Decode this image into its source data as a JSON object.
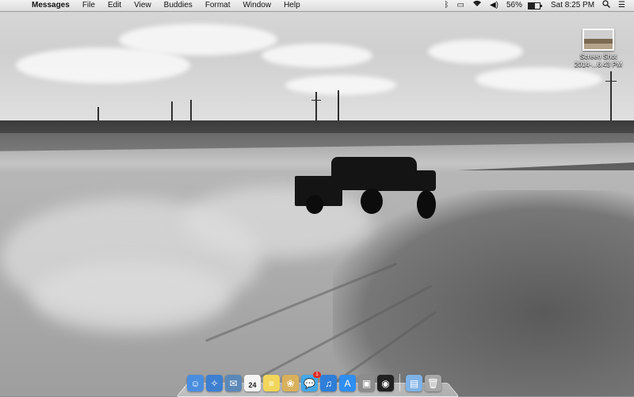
{
  "menubar": {
    "apple": "",
    "app_name": "Messages",
    "items": [
      "File",
      "Edit",
      "View",
      "Buddies",
      "Format",
      "Window",
      "Help"
    ],
    "status": {
      "bluetooth": "bluetooth-icon",
      "airplay": "airplay-icon",
      "wifi": "wifi-icon",
      "volume": "volume-icon",
      "battery_percent": "56%",
      "battery_level": 0.56,
      "clock": "Sat 8:25 PM",
      "search": "search-icon",
      "notification_center": "list-icon"
    }
  },
  "desktop": {
    "file": {
      "line1": "Screen Shot",
      "line2": "2014-...6.43 PM"
    }
  },
  "dock": {
    "items": [
      {
        "name": "finder",
        "icon": "finder-icon",
        "color": "#4a8ee0"
      },
      {
        "name": "safari",
        "icon": "safari-icon",
        "color": "#3d7fd0"
      },
      {
        "name": "mail",
        "icon": "mail-icon",
        "color": "#5b88b8"
      },
      {
        "name": "calendar",
        "icon": "calendar-icon",
        "color": "#f4f4f4",
        "label": "24"
      },
      {
        "name": "notes",
        "icon": "notes-icon",
        "color": "#f2d65a"
      },
      {
        "name": "photos",
        "icon": "photos-icon",
        "color": "#d9b15c"
      },
      {
        "name": "messages",
        "icon": "messages-icon",
        "color": "#44a7e8",
        "badge": "1"
      },
      {
        "name": "itunes",
        "icon": "itunes-icon",
        "color": "#2f7ed8"
      },
      {
        "name": "app-store",
        "icon": "app-store-icon",
        "color": "#2f8ef0"
      },
      {
        "name": "preview",
        "icon": "preview-icon",
        "color": "#8c8c8c"
      },
      {
        "name": "wireless-app",
        "icon": "wireless-icon",
        "color": "#202020"
      }
    ],
    "right_items": [
      {
        "name": "downloads-folder",
        "icon": "folder-icon",
        "color": "#7fb3e6"
      },
      {
        "name": "trash",
        "icon": "trash-icon",
        "color": "#a7a7a7"
      }
    ]
  }
}
